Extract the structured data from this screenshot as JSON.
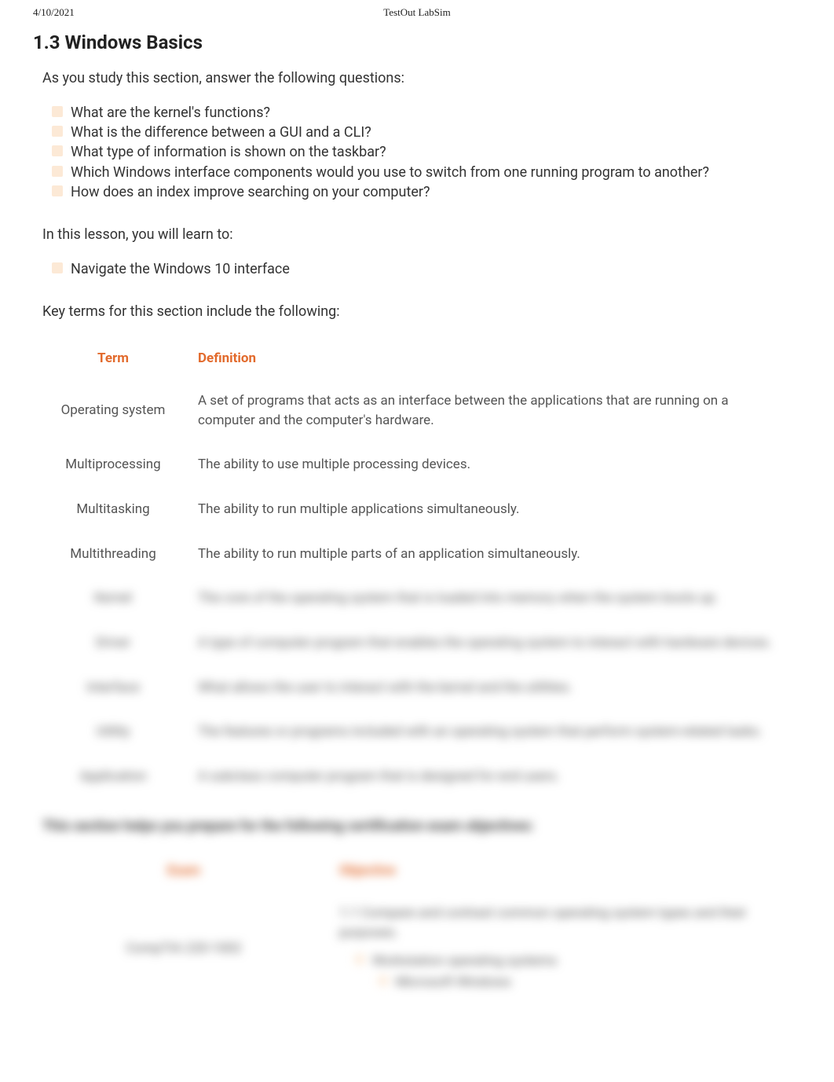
{
  "header": {
    "date": "4/10/2021",
    "title": "TestOut LabSim"
  },
  "section_title": "1.3 Windows Basics",
  "intro_text": "As you study this section, answer the following questions:",
  "questions": [
    "What are the kernel's functions?",
    "What is the difference between a GUI and a CLI?",
    "What type of information is shown on the taskbar?",
    "Which Windows interface components would you use to switch from one running program to another?",
    "How does an index improve searching on your computer?"
  ],
  "learn_intro": "In this lesson, you will learn to:",
  "learn_items": [
    "Navigate the Windows 10 interface"
  ],
  "keyterms_intro": "Key terms for this section include the following:",
  "terms_table": {
    "head_term": "Term",
    "head_def": "Definition",
    "rows": [
      {
        "term": "Operating system",
        "def": "A set of programs that acts as an interface between the applications that are running on a computer and the computer's hardware."
      },
      {
        "term": "Multiprocessing",
        "def": "The ability to use multiple processing devices."
      },
      {
        "term": "Multitasking",
        "def": "The ability to run multiple applications simultaneously."
      },
      {
        "term": "Multithreading",
        "def": "The ability to run multiple parts of an application simultaneously."
      },
      {
        "term": "Kernel",
        "def": "The core of the operating system that is loaded into memory when the system boots up."
      },
      {
        "term": "Driver",
        "def": "A type of computer program that enables the operating system to interact with hardware devices."
      },
      {
        "term": "Interface",
        "def": "What allows the user to interact with the kernel and the utilities."
      },
      {
        "term": "Utility",
        "def": "The features or programs included with an operating system that perform system-related tasks."
      },
      {
        "term": "Application",
        "def": "A subclass computer program that is designed for end users."
      }
    ]
  },
  "cert_intro": "This section helps you prepare for the following certification exam objectives:",
  "exam_table": {
    "head_exam": "Exam",
    "head_obj": "Objective",
    "rows": [
      {
        "exam": "CompTIA 220-1002",
        "obj_main": "1.1 Compare and contrast common operating system types and their purposes.",
        "obj_sub": [
          "Workstation operating systems",
          "Microsoft Windows"
        ]
      }
    ]
  }
}
